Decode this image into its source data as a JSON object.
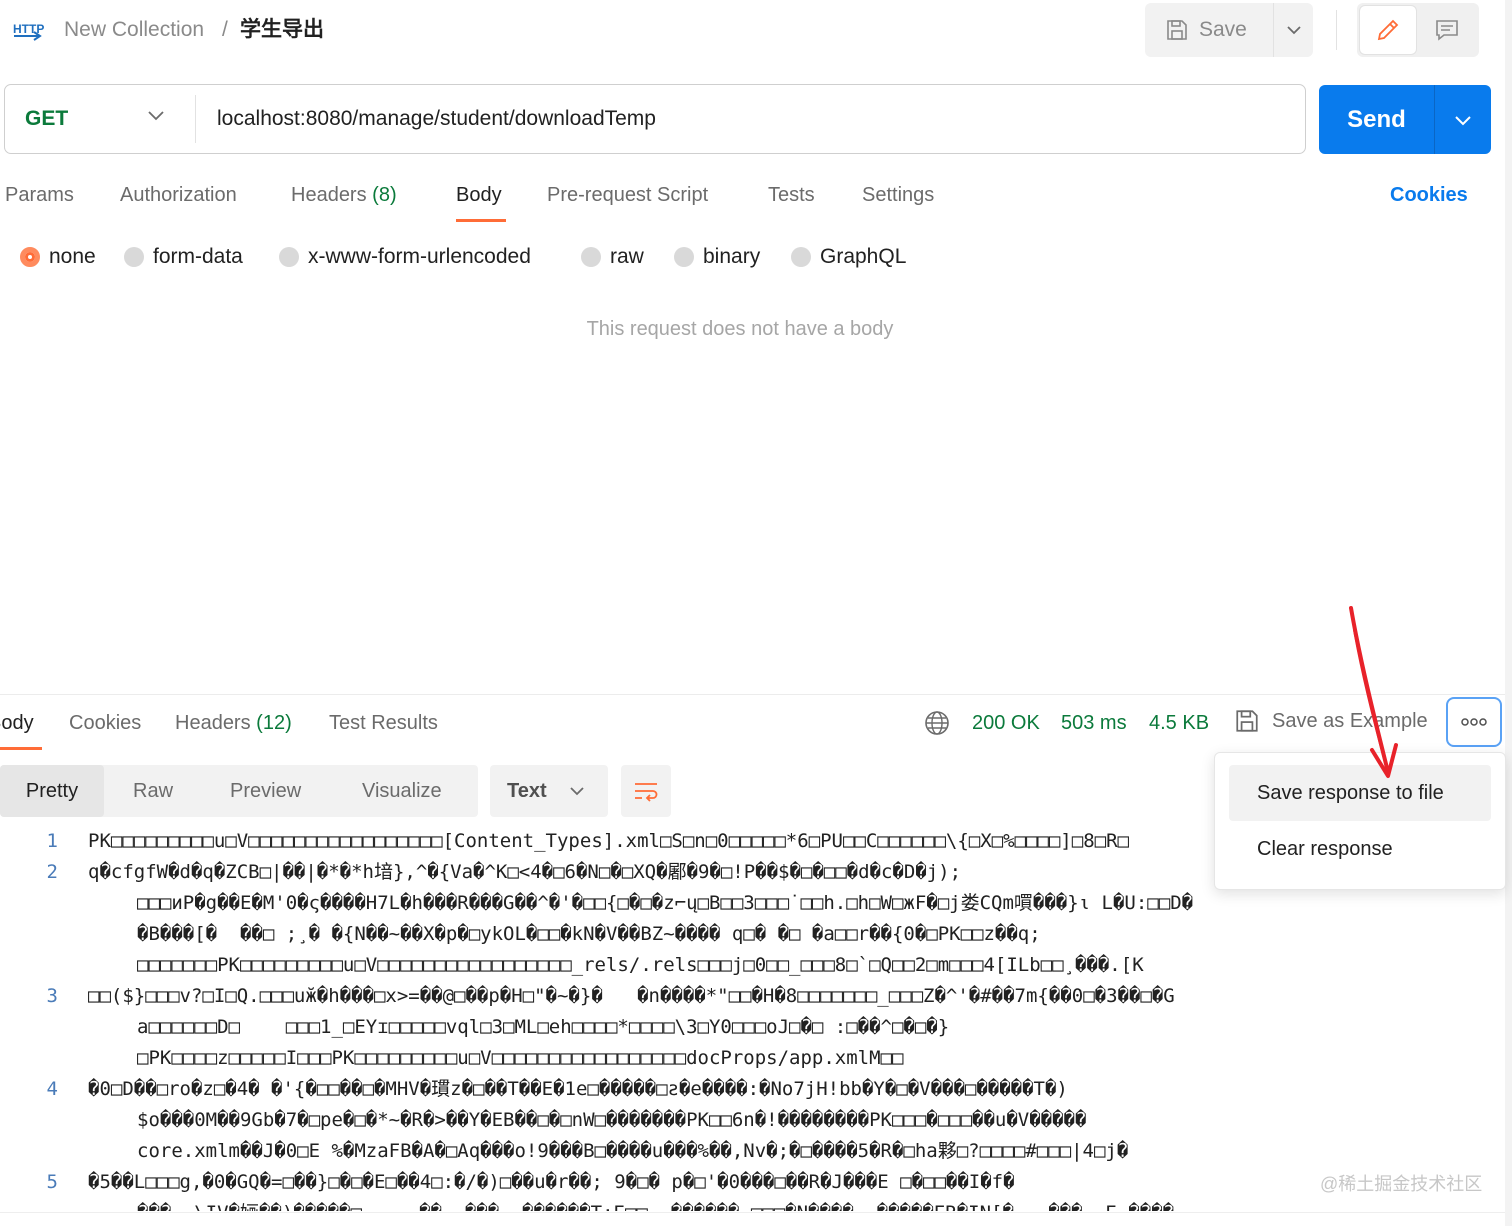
{
  "header": {
    "breadcrumb_collection": "New Collection",
    "breadcrumb_sep": "/",
    "request_name": "学生导出",
    "save_label": "Save"
  },
  "request": {
    "method": "GET",
    "url": "localhost:8080/manage/student/downloadTemp",
    "send_label": "Send"
  },
  "request_tabs": {
    "params": "Params",
    "authorization": "Authorization",
    "headers": "Headers",
    "headers_count": "(8)",
    "body": "Body",
    "pre_request": "Pre-request Script",
    "tests": "Tests",
    "settings": "Settings",
    "cookies": "Cookies"
  },
  "body_types": {
    "none": "none",
    "form_data": "form-data",
    "urlencoded": "x-www-form-urlencoded",
    "raw": "raw",
    "binary": "binary",
    "graphql": "GraphQL",
    "selected": "none"
  },
  "empty_body_message": "This request does not have a body",
  "response": {
    "tabs": {
      "body": "Body",
      "cookies": "Cookies",
      "headers": "Headers",
      "headers_count": "(12)",
      "test_results": "Test Results"
    },
    "status": "200 OK",
    "time": "503 ms",
    "size": "4.5 KB",
    "save_as_example": "Save as Example",
    "views": {
      "pretty": "Pretty",
      "raw": "Raw",
      "preview": "Preview",
      "visualize": "Visualize"
    },
    "format": "Text",
    "lines": [
      {
        "num": "1",
        "text": "PK□□□□□□□□□u□V□□□□□□□□□□□□□□□□□[Content_Types].xml□S□n□0□□□□□*6□PU□□C□□□□□□\\{□X□%□□□□]□8□R□"
      },
      {
        "num": "2",
        "text": "q�cfgfW�d�q�ZCB□|��|�*�*h堷},^�{Va�^K□<4�□6�N□�□XQ�䣝�9�□!P��$�□�□□�d�c�D�j);"
      },
      {
        "num": "",
        "text": "□□□иP�g��E�M'0�ς����H7L�h���R���G��^�'�□□{□�□�z⌐ų□B□□3□□□˙□□h.□h□W□жF�□j娄CQm嘪���}ι L�U:□□D�"
      },
      {
        "num": "",
        "text": "�B���[�  ��□ ;¸� �{N��~��X�p�□ykOL�□□�kN�V��BZ~���� q□� �□ �a□□r��{0�□PK□□z��q;"
      },
      {
        "num": "",
        "text": "□□□□□□□PK□□□□□□□□□u□V□□□□□□□□□□□□□□□□□_rels/.rels□□□j□0□□_□□□8□`□Q□□2□m□□□4[ILb□□¸���.[K"
      },
      {
        "num": "3",
        "text": "□□($}□□□v?□I□Q.□□□uӂ�h���□x>=��@□��p�H□\"�~�}�   �n����*\"□□�H�8□□□□□□□_□□□Z�^'�#��7m{��0□�3��□�G"
      },
      {
        "num": "",
        "text": "a□□□□□□D□    □□□1_□EYɪ□□□□□vql□3□ML□eh□□□□*□□□□\\3□Y0□□□oJ□�□ :□��^□�□�}"
      },
      {
        "num": "",
        "text": "□PK□□□□z□□□□□I□□□PK□□□□□□□□□u□V□□□□□□□□□□□□□□□□□docProps/app.xmlM□□"
      },
      {
        "num": "4",
        "text": "�0□D��□ro�z□�4� �'{�□□��□�MHV�瑻z�□��T��E�1e□�����□ƨ�e����:�No7jH!bb�Y�□�V���□�����T�)"
      },
      {
        "num": "",
        "text": "$o���0M��9Gb�7�□pe�□�*~�R�>��Y�EB��□�□nW□�������PK□□6n�!��������PK□□□�□□□��u�V�����"
      },
      {
        "num": "",
        "text": "core.xmlm��J�0□E %�MzaFB�A�□Aq���o!9���B□����u���%��,Nv�;�□����5�R�□ha夥□?□□□□#□□□|4□j�"
      },
      {
        "num": "5",
        "text": "�5��L□□□g,�0�GQ�=□��}□�□�E□��4□:�/�)□��u�r��; 9�□� p�□'�0���□��R�J���E □�□□��I�f�"
      },
      {
        "num": "",
        "text": "���  \\IV�婳��)�����□ ~   ��  ���  ������T:E□□  ������ □□□�N����  �����ER�IN[�   ���  E ����"
      }
    ]
  },
  "more_menu": {
    "save_to_file": "Save response to file",
    "clear": "Clear response"
  },
  "watermark": "@稀土掘金技术社区",
  "colors": {
    "accent": "#ff6c37",
    "send_blue": "#097bed",
    "status_green": "#0b7a3b",
    "annotation_arrow": "#e8222a"
  }
}
